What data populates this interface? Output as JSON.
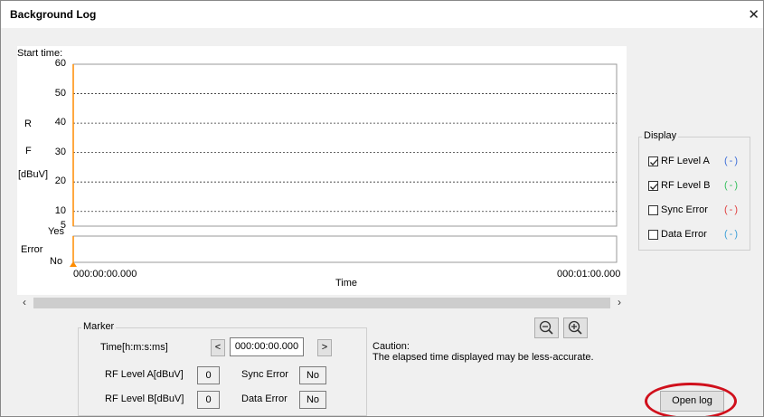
{
  "window": {
    "title": "Background Log",
    "close_glyph": "✕"
  },
  "chart_data": {
    "type": "line",
    "title": "Start time:",
    "ylabel_chars": [
      "R",
      "F",
      "[dBuV]"
    ],
    "ylim": [
      5,
      60
    ],
    "yticks": [
      "60",
      "50",
      "40",
      "30",
      "20",
      "10",
      "5"
    ],
    "error_label": "Error",
    "error_ticks": [
      "Yes",
      "No"
    ],
    "x_range_labels": [
      "000:00:00.000",
      "000:01:00.000"
    ],
    "xlabel": "Time",
    "series": []
  },
  "scrollbar": {
    "left": "‹",
    "right": "›"
  },
  "display": {
    "label": "Display",
    "items": [
      {
        "label": "RF Level A",
        "checked": true,
        "marker": "(-)",
        "color": "#3f6fd8"
      },
      {
        "label": "RF Level B",
        "checked": true,
        "marker": "(-)",
        "color": "#38c060"
      },
      {
        "label": "Sync Error",
        "checked": false,
        "marker": "(-)",
        "color": "#e04040"
      },
      {
        "label": "Data Error",
        "checked": false,
        "marker": "(-)",
        "color": "#3fa0d8"
      }
    ]
  },
  "marker": {
    "label": "Marker",
    "time_label": "Time[h:m:s:ms]",
    "prev": "<",
    "time_value": "000:00:00.000",
    "next": ">",
    "rfa_label": "RF Level A[dBuV]",
    "rfa_value": "0",
    "rfb_label": "RF Level B[dBuV]",
    "rfb_value": "0",
    "sync_label": "Sync Error",
    "sync_value": "No",
    "data_label": "Data Error",
    "data_value": "No"
  },
  "caution": {
    "title": "Caution:",
    "text": "The elapsed time displayed may be less-accurate."
  },
  "open_log": "Open log",
  "highlight_color": "#d0101c"
}
